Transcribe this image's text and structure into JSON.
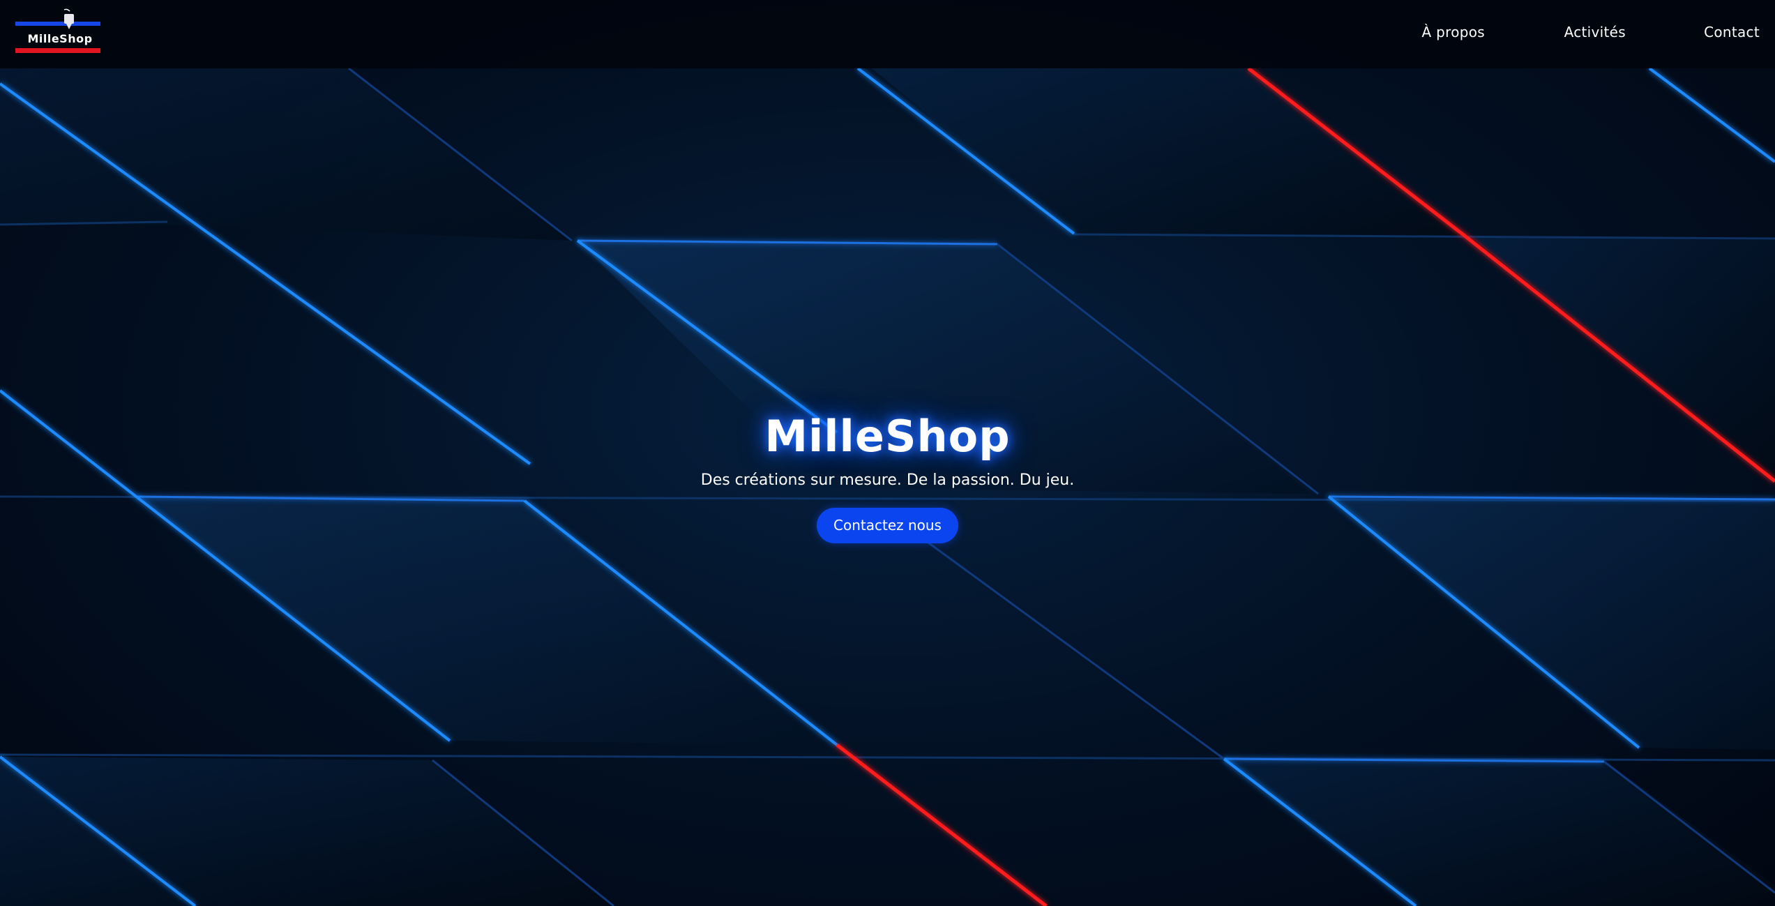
{
  "brand": {
    "logo_text": "MilleShop"
  },
  "nav": {
    "items": [
      {
        "label": "À propos"
      },
      {
        "label": "Activités"
      },
      {
        "label": "Contact"
      }
    ]
  },
  "hero": {
    "title": "MilleShop",
    "subtitle": "Des créations sur mesure. De la passion. Du jeu.",
    "cta_label": "Contactez nous"
  },
  "colors": {
    "accent_blue": "#0b45f0",
    "neon_blue": "#1f8bff",
    "neon_red": "#ff1a1a",
    "background": "#020611"
  }
}
